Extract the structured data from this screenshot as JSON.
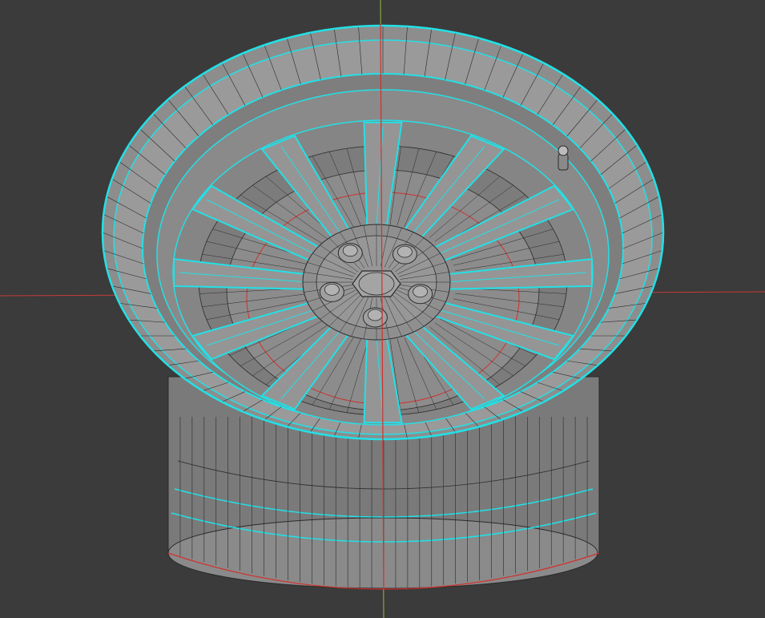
{
  "viewport": {
    "background": "#3b3b3b",
    "grid_axes": {
      "x_axis_color": "#c83a3a",
      "y_axis_color": "#8fbf3a"
    }
  },
  "model": {
    "object": "wheel",
    "spoke_count": 12,
    "lug_nut_count": 5,
    "has_valve_stem": true,
    "wireframe_visible": true,
    "selection_highlight": true
  },
  "colors": {
    "surface": "#8d8d8d",
    "surface_dark": "#6f6f6f",
    "surface_light": "#a6a6a6",
    "wire": "#2a2a2a",
    "selection": "#23e0e6",
    "seam": "#d0312d"
  }
}
